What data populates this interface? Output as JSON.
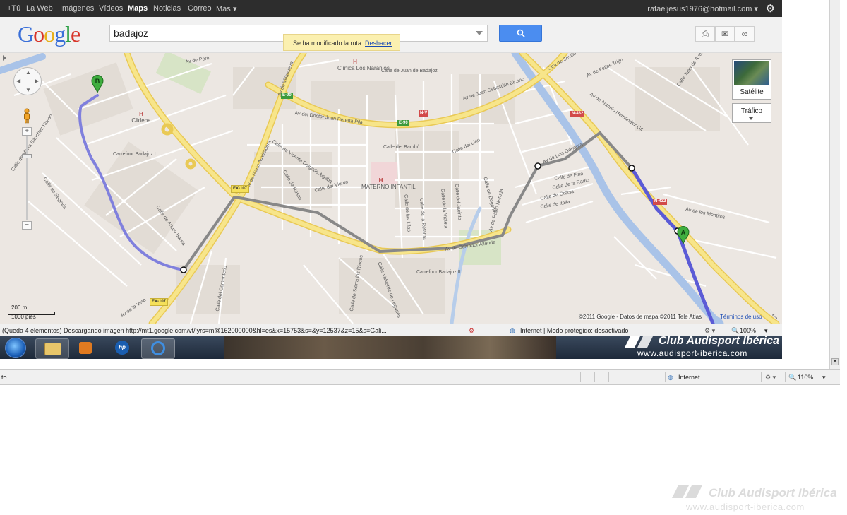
{
  "gbar": {
    "items": [
      "+Tú",
      "La Web",
      "Imágenes",
      "Vídeos",
      "Maps",
      "Noticias",
      "Correo",
      "Más ▾"
    ],
    "active_index": 4,
    "account": "rafaeljesus1976@hotmail.com ▾"
  },
  "logo": [
    "G",
    "o",
    "o",
    "g",
    "l",
    "e"
  ],
  "search": {
    "value": "badajoz"
  },
  "notice": {
    "message": "Se ha modificado la ruta.",
    "undo": "Deshacer"
  },
  "map": {
    "street_labels": [
      "Av de Perú",
      "Calle de Juan de Badajoz",
      "Av de Juan Sebastián Elcano",
      "Ctra de Sevilla",
      "Av de Felipe Trigo",
      "Calle Juan de Ávalos",
      "Av de Antonio Hernández Gil",
      "Av del Doctor Juan Pereda Pila",
      "Calle del Bambú",
      "Calle del Lirio",
      "Calle de Vicente Delgado Algaba",
      "Calle del Viento",
      "Av de María Auxiliadora",
      "Av de Villanueva",
      "Calle de María Sánchez Hueso",
      "Calle de Segovia",
      "Calle de Arturo Barea",
      "Av de Luis Góngora",
      "Calle de Fino",
      "Calle de la Radio",
      "Calle de Grecia",
      "Calle de Italia",
      "Av de los Montitos",
      "Av de Salvador Allende",
      "Calle de la Violeta",
      "Calle del Jacinto",
      "Calle de las Lilas",
      "Calle de la Retama",
      "Av de Pablo Neruda",
      "Calle de Sierra los Rincos",
      "Calle del Cementerio",
      "Av de la Vera",
      "Calle Valverde de Leganés",
      "Calle de Rosas",
      "Calle de Begonia"
    ],
    "places": [
      "Clínica Los Naranjos",
      "Clideba",
      "Carrefour Badajoz I",
      "MATERNO INFANTIL",
      "Carrefour Badajoz II"
    ],
    "shields": {
      "e90": "E-90",
      "nv": "N-V",
      "n432": "N-432",
      "ex107": "EX-107",
      "n432b": "N-432"
    },
    "markers": {
      "a": "A",
      "b": "B"
    },
    "zoom": {
      "plus": "+",
      "minus": "−"
    },
    "scale": {
      "metric": "200 m",
      "imperial": "1000 pies"
    },
    "satellite_label": "Satélite",
    "traffic_label": "Tráfico",
    "copyright": "©2011 Google - Datos de mapa ©2011 Tele Atlas",
    "terms": "Términos de uso"
  },
  "statusbar": {
    "loading": "(Queda 4 elementos) Descargando imagen http://mt1.google.com/vt/lyrs=m@162000000&hl=es&x=15753&s=&y=12537&z=15&s=Gali...",
    "zone": "Internet | Modo protegido: desactivado",
    "zoom": "100%"
  },
  "watermark": {
    "title": "Club Audisport Ibérica",
    "url": "www.audisport-iberica.com"
  },
  "outer_status": {
    "left": "to",
    "zone": "Internet",
    "zoom": "110%"
  },
  "colors": {
    "route_gray": "#888888",
    "route_blue": "#5b5bd6",
    "route_blue_light": "#8080dd",
    "highway": "#f6e27a",
    "river": "#a9c3e8",
    "taskbar": "#1e2a3a",
    "search_button": "#4b8df0"
  }
}
